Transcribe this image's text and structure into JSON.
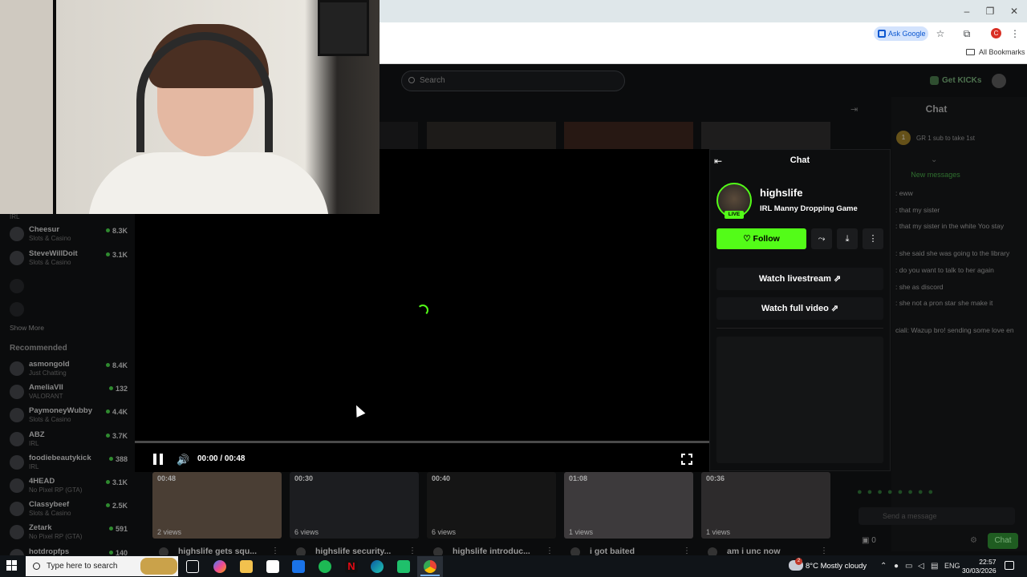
{
  "browser": {
    "ask_google": "Ask Google",
    "all_bookmarks": "All Bookmarks",
    "profile_initial": "C",
    "icons": [
      "minimize-icon",
      "maximize-icon",
      "close-icon",
      "star-icon",
      "extensions-icon",
      "menu-icon"
    ]
  },
  "site": {
    "search_placeholder": "Search",
    "get_kicks": "Get KICKs"
  },
  "sidebar": {
    "following": [
      {
        "name": "Cheesur",
        "category": "Slots & Casino",
        "viewers": "8.3K"
      },
      {
        "name": "SteveWillDoit",
        "category": "Slots & Casino",
        "viewers": "3.1K"
      }
    ],
    "show_more": "Show More",
    "recommended_label": "Recommended",
    "recommended": [
      {
        "name": "asmongold",
        "category": "Just Chatting",
        "viewers": "8.4K"
      },
      {
        "name": "AmeliaVII",
        "category": "VALORANT",
        "viewers": "132"
      },
      {
        "name": "PaymoneyWubby",
        "category": "Slots & Casino",
        "viewers": "4.4K"
      },
      {
        "name": "ABZ",
        "category": "IRL",
        "viewers": "3.7K"
      },
      {
        "name": "foodiebeautykick",
        "category": "IRL",
        "viewers": "388"
      },
      {
        "name": "4HEAD",
        "category": "No Pixel RP (GTA)",
        "viewers": "3.1K"
      },
      {
        "name": "Classybeef",
        "category": "Slots & Casino",
        "viewers": "2.5K"
      },
      {
        "name": "Zetark",
        "category": "No Pixel RP (GTA)",
        "viewers": "591"
      },
      {
        "name": "hotdropfps",
        "category": "",
        "viewers": "140"
      }
    ],
    "top_partial_category": "IRL"
  },
  "player": {
    "time": "00:00 / 00:48",
    "progress": 0.0
  },
  "clip_panel": {
    "title": "Chat",
    "channel": "highslife",
    "category": "IRL Manny Dropping Game",
    "live_badge": "LIVE",
    "follow_label": "Follow",
    "watch_livestream": "Watch livestream",
    "watch_full_video": "Watch full video"
  },
  "clips": [
    {
      "duration": "00:48",
      "views": "2 views",
      "title": "highslife gets squ..."
    },
    {
      "duration": "00:30",
      "views": "6 views",
      "title": "highslife security..."
    },
    {
      "duration": "00:40",
      "views": "6 views",
      "title": "highslife introduc..."
    },
    {
      "duration": "01:08",
      "views": "1 views",
      "title": "i got baited"
    },
    {
      "duration": "00:36",
      "views": "1 views",
      "title": "am i unc now"
    }
  ],
  "bg_chat": {
    "title": "Chat",
    "sub_badge": "1",
    "sub_text": "GR 1 sub to take 1st",
    "new_messages": "New messages",
    "messages": [
      ": eww",
      ": that my sister",
      ": that my sister in the white Yoo stay",
      ": she said she was going to the library",
      ": do you want to talk to her again",
      ": she as discord",
      ": she not a pron star she make it",
      "ciali: Wazup bro! sending some love en"
    ],
    "send_placeholder": "Send a message",
    "count": "0",
    "chat_button": "Chat"
  },
  "taskbar": {
    "search_placeholder": "Type here to search",
    "weather": "8°C  Mostly cloudy",
    "weather_badge": "2",
    "lang": "ENG",
    "time": "22:57",
    "date": "30/03/2026"
  },
  "colors": {
    "accent": "#53fc18",
    "background": "#0b0c0d",
    "panel": "#0d0e0f"
  }
}
